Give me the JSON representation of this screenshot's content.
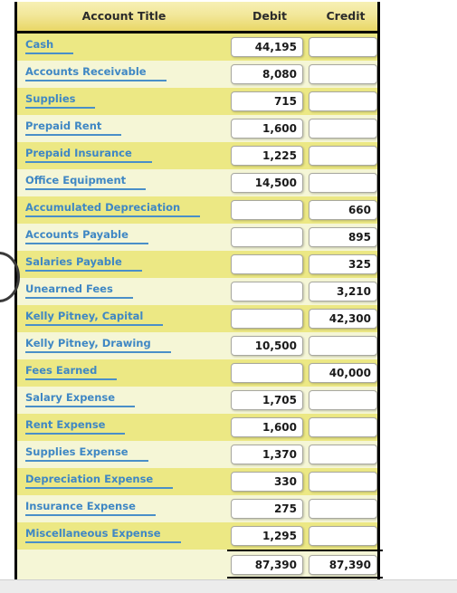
{
  "table": {
    "columns": {
      "account": "Account Title",
      "debit": "Debit",
      "credit": "Credit"
    },
    "rows": [
      {
        "account": "Cash",
        "debit": "44,195",
        "credit": ""
      },
      {
        "account": "Accounts Receivable",
        "debit": "8,080",
        "credit": ""
      },
      {
        "account": "Supplies",
        "debit": "715",
        "credit": ""
      },
      {
        "account": "Prepaid Rent",
        "debit": "1,600",
        "credit": ""
      },
      {
        "account": "Prepaid Insurance",
        "debit": "1,225",
        "credit": ""
      },
      {
        "account": "Office Equipment",
        "debit": "14,500",
        "credit": ""
      },
      {
        "account": "Accumulated Depreciation",
        "debit": "",
        "credit": "660"
      },
      {
        "account": "Accounts Payable",
        "debit": "",
        "credit": "895"
      },
      {
        "account": "Salaries Payable",
        "debit": "",
        "credit": "325"
      },
      {
        "account": "Unearned Fees",
        "debit": "",
        "credit": "3,210"
      },
      {
        "account": "Kelly Pitney, Capital",
        "debit": "",
        "credit": "42,300"
      },
      {
        "account": "Kelly Pitney, Drawing",
        "debit": "10,500",
        "credit": ""
      },
      {
        "account": "Fees Earned",
        "debit": "",
        "credit": "40,000"
      },
      {
        "account": "Salary Expense",
        "debit": "1,705",
        "credit": ""
      },
      {
        "account": "Rent Expense",
        "debit": "1,600",
        "credit": ""
      },
      {
        "account": "Supplies Expense",
        "debit": "1,370",
        "credit": ""
      },
      {
        "account": "Depreciation Expense",
        "debit": "330",
        "credit": ""
      },
      {
        "account": "Insurance Expense",
        "debit": "275",
        "credit": ""
      },
      {
        "account": "Miscellaneous Expense",
        "debit": "1,295",
        "credit": ""
      }
    ],
    "totals": {
      "account": "",
      "debit": "87,390",
      "credit": "87,390"
    }
  },
  "colors": {
    "row_odd": "#ece884",
    "row_even": "#f5f6d6",
    "header_gradient_top": "#f7f0b4",
    "header_gradient_bottom": "#e9d765",
    "link_blue": "#3f87c4",
    "rule_blue": "#4a8fc8",
    "border_black": "#000000"
  }
}
